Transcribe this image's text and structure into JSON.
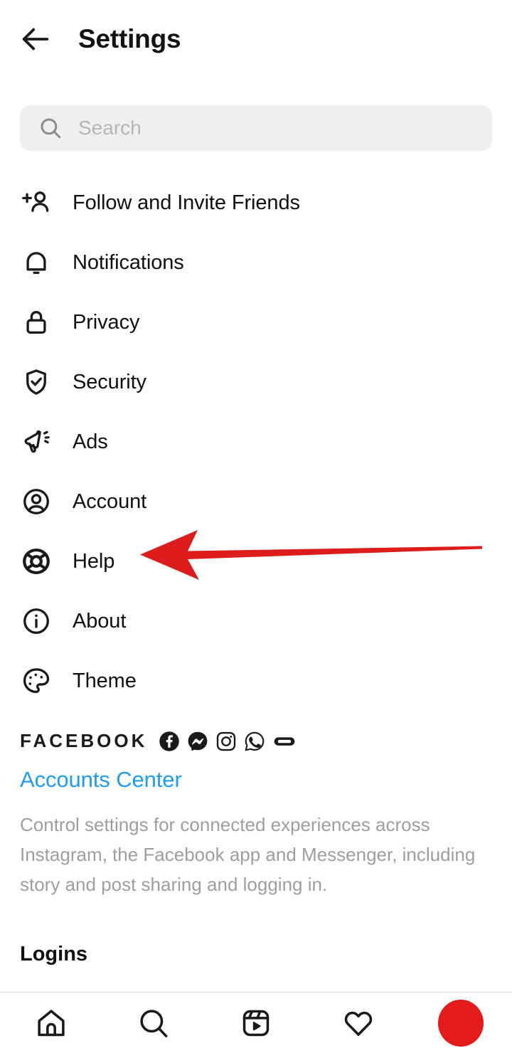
{
  "header": {
    "title": "Settings",
    "back_icon": "arrow-left-icon"
  },
  "search": {
    "placeholder": "Search",
    "icon": "search-icon",
    "value": ""
  },
  "menu": {
    "items": [
      {
        "label": "Follow and Invite Friends",
        "icon": "person-add-icon"
      },
      {
        "label": "Notifications",
        "icon": "bell-icon"
      },
      {
        "label": "Privacy",
        "icon": "lock-icon"
      },
      {
        "label": "Security",
        "icon": "shield-check-icon"
      },
      {
        "label": "Ads",
        "icon": "megaphone-icon"
      },
      {
        "label": "Account",
        "icon": "person-circle-icon"
      },
      {
        "label": "Help",
        "icon": "lifebuoy-icon"
      },
      {
        "label": "About",
        "icon": "info-circle-icon"
      },
      {
        "label": "Theme",
        "icon": "palette-icon"
      }
    ]
  },
  "facebook_section": {
    "wordmark": "FACEBOOK",
    "app_icons": [
      {
        "name": "facebook-icon"
      },
      {
        "name": "messenger-icon"
      },
      {
        "name": "instagram-icon"
      },
      {
        "name": "whatsapp-icon"
      },
      {
        "name": "oculus-icon"
      }
    ],
    "link_label": "Accounts Center",
    "link_color": "#1f9bf0",
    "description": "Control settings for connected experiences across Instagram, the Facebook app and Messenger, including story and post sharing and logging in."
  },
  "logins_section": {
    "heading": "Logins"
  },
  "bottom_nav": {
    "items": [
      {
        "name": "home-icon"
      },
      {
        "name": "search-icon"
      },
      {
        "name": "reels-icon"
      },
      {
        "name": "heart-icon"
      },
      {
        "name": "profile-avatar"
      }
    ],
    "avatar_color": "#e51b1b"
  },
  "annotation": {
    "type": "arrow",
    "color": "#dd1c1c",
    "points_to": "Help"
  }
}
